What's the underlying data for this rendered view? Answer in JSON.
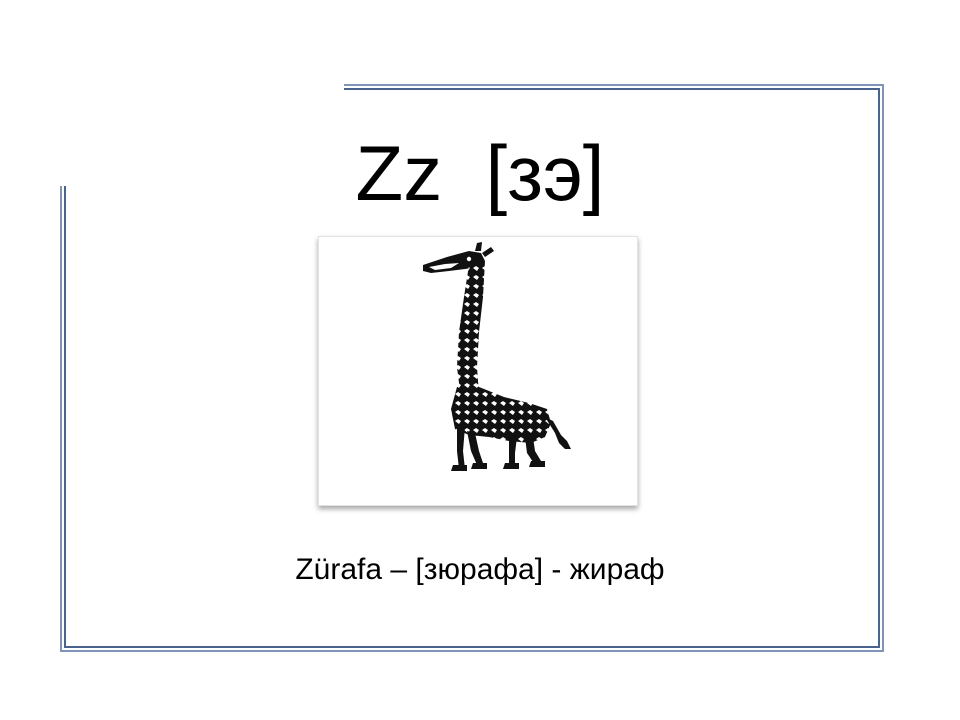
{
  "slide": {
    "title": "Zz  [зэ]",
    "caption": "Zürafa – [зюрафа] - жираф",
    "image_icon": "giraffe-icon",
    "frame_color": "#7f95b8",
    "frame_shadow_color": "#4a648f"
  }
}
